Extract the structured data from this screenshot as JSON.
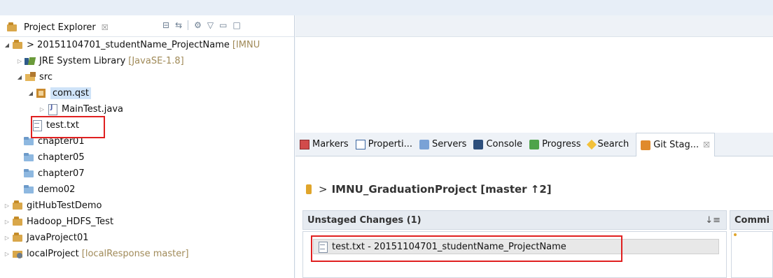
{
  "explorer": {
    "title": "Project Explorer",
    "tree": [
      {
        "label": "> 20151104701_studentName_ProjectName",
        "decoration": "[IMNU",
        "icon": "project-icon",
        "expanded": true
      },
      {
        "label": "JRE System Library",
        "decoration": "[JavaSE-1.8]",
        "icon": "jre-library-icon",
        "expanded": false
      },
      {
        "label": "src",
        "icon": "source-folder-icon",
        "expanded": true
      },
      {
        "label": "com.qst",
        "icon": "package-icon",
        "expanded": true
      },
      {
        "label": "MainTest.java",
        "icon": "java-file-icon",
        "expanded": false
      },
      {
        "label": "test.txt",
        "icon": "text-file-icon"
      },
      {
        "label": "chapter01",
        "icon": "folder-icon"
      },
      {
        "label": "chapter05",
        "icon": "folder-icon"
      },
      {
        "label": "chapter07",
        "icon": "folder-icon"
      },
      {
        "label": "demo02",
        "icon": "folder-icon"
      },
      {
        "label": "gitHubTestDemo",
        "icon": "project-icon",
        "expanded": false
      },
      {
        "label": "Hadoop_HDFS_Test",
        "icon": "project-icon",
        "expanded": false
      },
      {
        "label": "JavaProject01",
        "icon": "project-icon",
        "expanded": false
      },
      {
        "label": "localProject",
        "decoration": "[localResponse master]",
        "icon": "git-project-icon",
        "expanded": false
      }
    ]
  },
  "views": {
    "tabs": [
      {
        "label": "Markers",
        "icon": "markers-icon"
      },
      {
        "label": "Properti...",
        "icon": "properties-icon"
      },
      {
        "label": "Servers",
        "icon": "servers-icon"
      },
      {
        "label": "Console",
        "icon": "console-icon"
      },
      {
        "label": "Progress",
        "icon": "progress-icon"
      },
      {
        "label": "Search",
        "icon": "search-icon"
      },
      {
        "label": "Git Stag...",
        "icon": "git-staging-icon",
        "active": true
      }
    ]
  },
  "staging": {
    "repo_prefix": ">",
    "repo": "IMNU_GraduationProject [master ↑2]",
    "unstaged_header": "Unstaged Changes (1)",
    "commit_header": "Commi",
    "unstaged_items": [
      "test.txt - 20151104701_studentName_ProjectName"
    ]
  },
  "colors": {
    "highlight_box": "#e02020",
    "selection": "#cfe3f8"
  }
}
